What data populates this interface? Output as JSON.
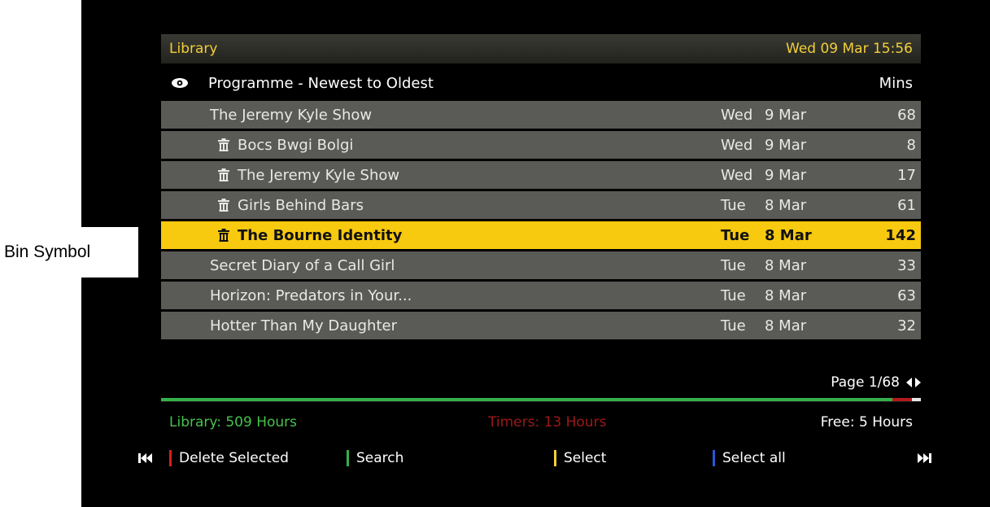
{
  "annotation": {
    "label": "Bin Symbol"
  },
  "header": {
    "title": "Library",
    "datetime": "Wed 09 Mar 15:56"
  },
  "columns": {
    "sort_label": "Programme - Newest to Oldest",
    "mins_label": "Mins",
    "sort_icon": "eye-icon"
  },
  "recordings": [
    {
      "title": "The Jeremy Kyle Show",
      "day": "Wed",
      "date": "9 Mar",
      "mins": "68",
      "bin": false,
      "selected": false
    },
    {
      "title": "Bocs Bwgi Bolgi",
      "day": "Wed",
      "date": "9 Mar",
      "mins": "8",
      "bin": true,
      "selected": false
    },
    {
      "title": "The Jeremy Kyle Show",
      "day": "Wed",
      "date": "9 Mar",
      "mins": "17",
      "bin": true,
      "selected": false
    },
    {
      "title": "Girls Behind Bars",
      "day": "Tue",
      "date": "8 Mar",
      "mins": "61",
      "bin": true,
      "selected": false
    },
    {
      "title": "The Bourne Identity",
      "day": "Tue",
      "date": "8 Mar",
      "mins": "142",
      "bin": true,
      "selected": true
    },
    {
      "title": "Secret Diary of a Call Girl",
      "day": "Tue",
      "date": "8 Mar",
      "mins": "33",
      "bin": false,
      "selected": false
    },
    {
      "title": "Horizon: Predators in Your...",
      "day": "Tue",
      "date": "8 Mar",
      "mins": "63",
      "bin": false,
      "selected": false
    },
    {
      "title": "Hotter Than My Daughter",
      "day": "Tue",
      "date": "8 Mar",
      "mins": "32",
      "bin": false,
      "selected": false
    }
  ],
  "pager": {
    "label": "Page 1/68"
  },
  "usage": {
    "library_fraction": 0.963,
    "timers_fraction": 0.026,
    "free_fraction": 0.011
  },
  "stats": {
    "library": "Library: 509 Hours",
    "timers": "Timers: 13 Hours",
    "free": "Free: 5 Hours"
  },
  "footer": {
    "delete_label": "Delete Selected",
    "search_label": "Search",
    "select_label": "Select",
    "select_all_label": "Select all"
  },
  "colors": {
    "accent_yellow": "#f7c90f",
    "title_yellow": "#f2cf38",
    "red_key": "#d62020",
    "green_key": "#35b04a",
    "yellow_key": "#f2cf38",
    "blue_key": "#2a55d6"
  }
}
